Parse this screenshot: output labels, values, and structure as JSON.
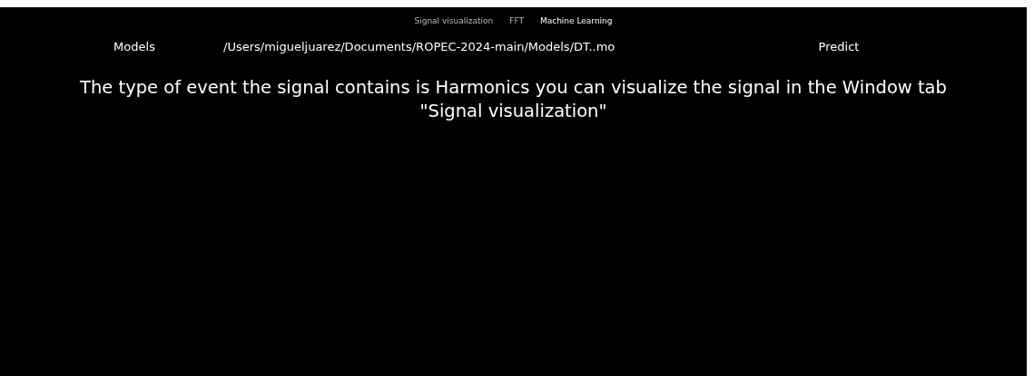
{
  "tabs": [
    {
      "label": "Signal visualization",
      "selected": false
    },
    {
      "label": "FFT",
      "selected": false
    },
    {
      "label": "Machine Learning",
      "selected": true
    }
  ],
  "models_button": {
    "label": "Models"
  },
  "model_path": "/Users/migueljuarez/Documents/ROPEC-2024-main/Models/DT..mo",
  "predict_button": {
    "label": "Predict"
  },
  "message": "The type of event the signal contains is Harmonics you can visualize the signal in the Window tab \"Signal visualization\""
}
